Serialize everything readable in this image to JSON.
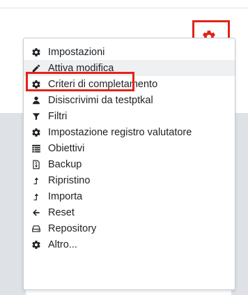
{
  "colors": {
    "accent_red": "#e2231a",
    "text": "#1d2125",
    "menu_border": "#c7cbcf",
    "panel_gray": "#dee2e6",
    "hover_bg": "#eef0f2"
  },
  "header": {
    "settings_button_icon": "gear-icon",
    "settings_button_caret": "caret-down-icon"
  },
  "menu": {
    "items": [
      {
        "label": "Impostazioni",
        "icon": "gear-icon"
      },
      {
        "label": "Attiva modifica",
        "icon": "pencil-icon"
      },
      {
        "label": "Criteri di completamento",
        "icon": "gear-icon"
      },
      {
        "label": "Disiscrivimi da testptkal",
        "icon": "user-icon"
      },
      {
        "label": "Filtri",
        "icon": "filter-icon"
      },
      {
        "label": "Impostazione registro valutatore",
        "icon": "gear-icon"
      },
      {
        "label": "Obiettivi",
        "icon": "list-icon"
      },
      {
        "label": "Backup",
        "icon": "file-archive-icon"
      },
      {
        "label": "Ripristino",
        "icon": "level-up-icon"
      },
      {
        "label": "Importa",
        "icon": "level-up-icon"
      },
      {
        "label": "Reset",
        "icon": "arrow-left-icon"
      },
      {
        "label": "Repository",
        "icon": "drive-icon"
      },
      {
        "label": "Altro...",
        "icon": "gear-icon"
      }
    ]
  }
}
